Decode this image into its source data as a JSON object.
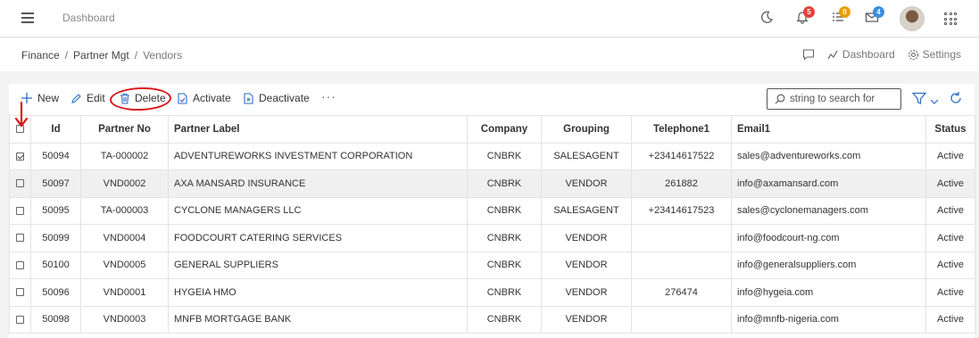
{
  "topbar": {
    "title": "Dashboard",
    "notifications_count": "5",
    "tasks_count": "0",
    "messages_count": "4",
    "badge_colors": {
      "notifications": "#e0423b",
      "tasks": "#e6a100",
      "messages": "#3b8fe0"
    }
  },
  "breadcrumb": {
    "items": [
      "Finance",
      "Partner Mgt",
      "Vendors"
    ],
    "dashboard_link": "Dashboard",
    "settings_link": "Settings"
  },
  "toolbar": {
    "new_label": "New",
    "edit_label": "Edit",
    "delete_label": "Delete",
    "activate_label": "Activate",
    "deactivate_label": "Deactivate",
    "more_label": "···",
    "search_placeholder": "string to search for",
    "annotation_color": "#d9161c"
  },
  "table": {
    "headers": [
      "Id",
      "Partner No",
      "Partner Label",
      "Company",
      "Grouping",
      "Telephone1",
      "Email1",
      "Status"
    ],
    "rows": [
      {
        "checked": true,
        "id": "50094",
        "partner_no": "TA-000002",
        "label": "ADVENTUREWORKS INVESTMENT CORPORATION",
        "company": "CNBRK",
        "grouping": "SALESAGENT",
        "telephone": "+23414617522",
        "email": "sales@adventureworks.com",
        "status": "Active"
      },
      {
        "checked": false,
        "id": "50097",
        "partner_no": "VND0002",
        "label": "AXA MANSARD INSURANCE",
        "company": "CNBRK",
        "grouping": "VENDOR",
        "telephone": "261882",
        "email": "info@axamansard.com",
        "status": "Active"
      },
      {
        "checked": false,
        "id": "50095",
        "partner_no": "TA-000003",
        "label": "CYCLONE MANAGERS LLC",
        "company": "CNBRK",
        "grouping": "SALESAGENT",
        "telephone": "+23414617523",
        "email": "sales@cyclonemanagers.com",
        "status": "Active"
      },
      {
        "checked": false,
        "id": "50099",
        "partner_no": "VND0004",
        "label": "FOODCOURT CATERING SERVICES",
        "company": "CNBRK",
        "grouping": "VENDOR",
        "telephone": "",
        "email": "info@foodcourt-ng.com",
        "status": "Active"
      },
      {
        "checked": false,
        "id": "50100",
        "partner_no": "VND0005",
        "label": "GENERAL SUPPLIERS",
        "company": "CNBRK",
        "grouping": "VENDOR",
        "telephone": "",
        "email": "info@generalsuppliers.com",
        "status": "Active"
      },
      {
        "checked": false,
        "id": "50096",
        "partner_no": "VND0001",
        "label": "HYGEIA HMO",
        "company": "CNBRK",
        "grouping": "VENDOR",
        "telephone": "276474",
        "email": "info@hygeia.com",
        "status": "Active"
      },
      {
        "checked": false,
        "id": "50098",
        "partner_no": "VND0003",
        "label": "MNFB MORTGAGE BANK",
        "company": "CNBRK",
        "grouping": "VENDOR",
        "telephone": "",
        "email": "info@mnfb-nigeria.com",
        "status": "Active"
      }
    ]
  }
}
